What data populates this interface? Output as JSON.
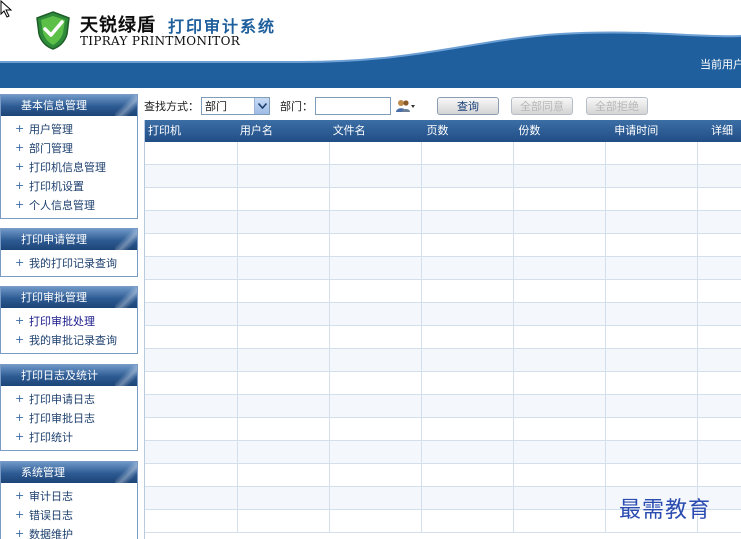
{
  "header": {
    "brand_cn": "天锐绿盾",
    "brand_sub": "打印审计系统",
    "brand_en": "TIPRAY PRINTMONITOR",
    "current_user": "当前用户"
  },
  "sidebar": {
    "panels": [
      {
        "title": "基本信息管理",
        "items": [
          "用户管理",
          "部门管理",
          "打印机信息管理",
          "打印机设置",
          "个人信息管理"
        ]
      },
      {
        "title": "打印申请管理",
        "items": [
          "我的打印记录查询"
        ]
      },
      {
        "title": "打印审批管理",
        "items": [
          "打印审批处理",
          "我的审批记录查询"
        ]
      },
      {
        "title": "打印日志及统计",
        "items": [
          "打印申请日志",
          "打印审批日志",
          "打印统计"
        ]
      },
      {
        "title": "系统管理",
        "items": [
          "审计日志",
          "错误日志",
          "数据维护"
        ]
      }
    ]
  },
  "toolbar": {
    "search_mode_label": "查找方式：",
    "search_mode_value": "部门",
    "dept_label": "部门：",
    "dept_value": "",
    "query_button": "查询",
    "approve_all_button": "全部同意",
    "reject_all_button": "全部拒绝"
  },
  "grid": {
    "columns": [
      "打印机",
      "用户名",
      "文件名",
      "页数",
      "份数",
      "申请时间",
      "详细"
    ]
  },
  "watermark": "最需教育",
  "colors": {
    "header_blue": "#1f5f9e",
    "panel_head": "#2c5a92",
    "grid_head": "#2a5a93",
    "brand_blue": "#1e5f9c"
  }
}
